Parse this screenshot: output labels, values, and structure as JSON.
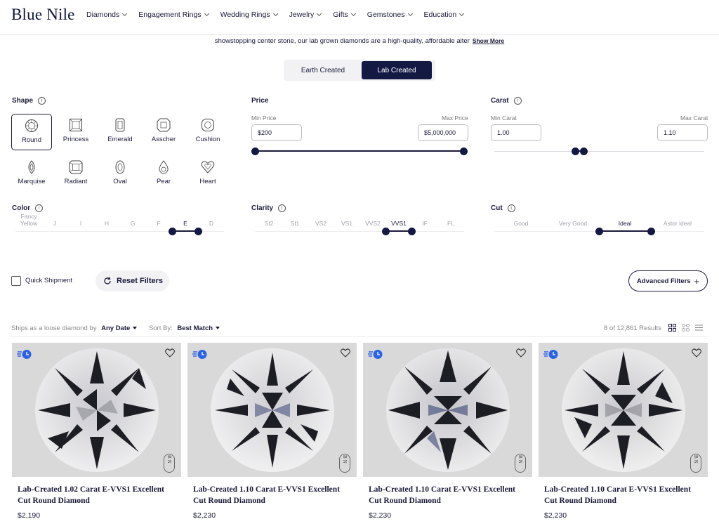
{
  "brand": "Blue Nile",
  "nav": [
    "Diamonds",
    "Engagement Rings",
    "Wedding Rings",
    "Jewelry",
    "Gifts",
    "Gemstones",
    "Education"
  ],
  "intro": {
    "text": "showstopping center stone, our lab grown diamonds are a high-quality, affordable alter",
    "more": "Show More"
  },
  "toggle": {
    "earth": "Earth Created",
    "lab": "Lab Created",
    "selected": "Lab Created"
  },
  "shape": {
    "title": "Shape",
    "selected": "Round",
    "items": [
      "Round",
      "Princess",
      "Emerald",
      "Asscher",
      "Cushion",
      "Marquise",
      "Radiant",
      "Oval",
      "Pear",
      "Heart"
    ]
  },
  "price": {
    "title": "Price",
    "min_label": "Min Price",
    "max_label": "Max Price",
    "min": "$200",
    "max": "$5,000,000",
    "range_fraction": [
      0,
      1
    ]
  },
  "carat": {
    "title": "Carat",
    "min_label": "Min Carat",
    "max_label": "Max Carat",
    "min": "1.00",
    "max": "1.10"
  },
  "color": {
    "title": "Color",
    "grades": [
      "Fancy Yellow",
      "J",
      "I",
      "H",
      "G",
      "F",
      "E",
      "D"
    ],
    "selected": [
      "E"
    ]
  },
  "clarity": {
    "title": "Clarity",
    "grades": [
      "SI2",
      "SI1",
      "VS2",
      "VS1",
      "VVS2",
      "VVS1",
      "IF",
      "FL"
    ],
    "selected": [
      "VVS1"
    ]
  },
  "cut": {
    "title": "Cut",
    "grades": [
      "Good",
      "Very Good",
      "Ideal",
      "Astor ideal"
    ],
    "selected": [
      "Ideal"
    ]
  },
  "filters": {
    "quick_shipment": "Quick Shipment",
    "reset": "Reset Filters",
    "advanced": "Advanced Filters"
  },
  "results": {
    "ships_label": "Ships as a loose diamond by",
    "ships_value": "Any Date",
    "sort_label": "Sort By:",
    "sort_value": "Best Match",
    "count": "8 of 12,861 Results"
  },
  "products": [
    {
      "title": "Lab-Created 1.02 Carat E-VVS1 Excellent Cut Round Diamond",
      "price": "$2,190"
    },
    {
      "title": "Lab-Created 1.10 Carat E-VVS1 Excellent Cut Round Diamond",
      "price": "$2,230"
    },
    {
      "title": "Lab-Created 1.10 Carat E-VVS1 Excellent Cut Round Diamond",
      "price": "$2,230"
    },
    {
      "title": "Lab-Created 1.10 Carat E-VVS1 Excellent Cut Round Diamond",
      "price": "$2,230"
    }
  ],
  "watermark_monogram": "BN",
  "colors": {
    "navy": "#141944",
    "badge_blue": "#2a63e6",
    "image_bg": "#d9d9da"
  }
}
